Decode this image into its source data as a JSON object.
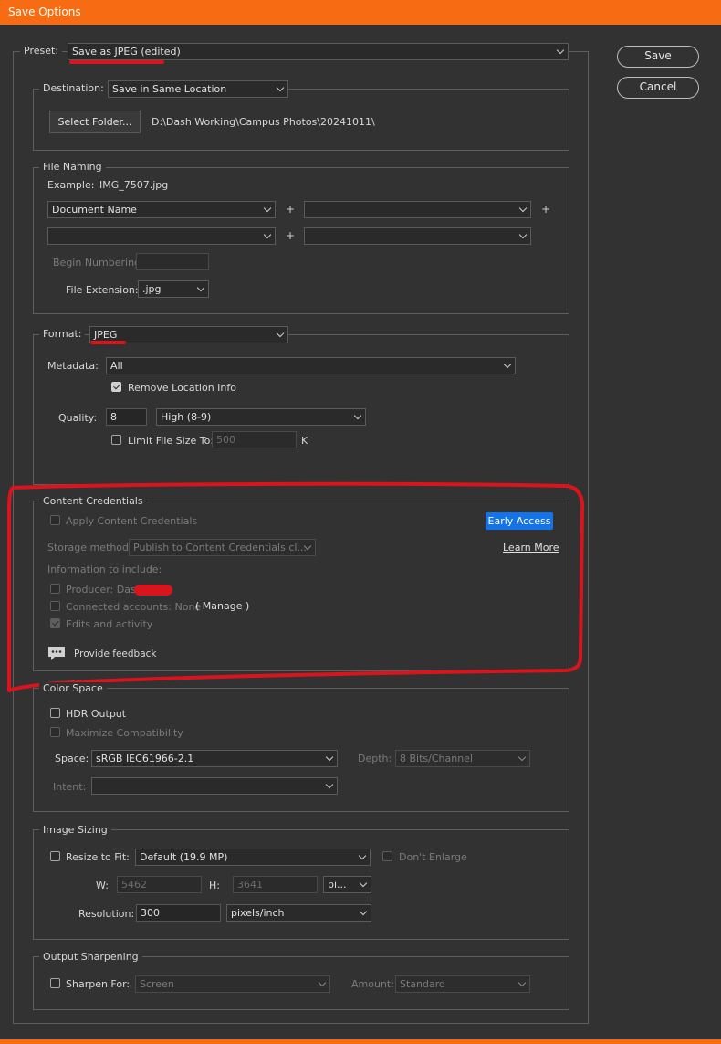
{
  "window": {
    "title": "Save Options"
  },
  "preset": {
    "label": "Preset:",
    "value": "Save as JPEG (edited)"
  },
  "buttons": {
    "save": "Save",
    "cancel": "Cancel"
  },
  "destination": {
    "label": "Destination:",
    "value": "Save in Same Location",
    "select_folder": "Select Folder...",
    "path": "D:\\Dash Working\\Campus Photos\\20241011\\"
  },
  "file_naming": {
    "title": "File Naming",
    "example_label": "Example:",
    "example_value": "IMG_7507.jpg",
    "field1": "Document Name",
    "field2": "",
    "field3": "",
    "field4": "",
    "plus": "+",
    "begin_numbering_label": "Begin Numbering:",
    "begin_numbering_value": "",
    "file_ext_label": "File Extension:",
    "file_ext_value": ".jpg"
  },
  "format": {
    "label": "Format:",
    "value": "JPEG",
    "metadata_label": "Metadata:",
    "metadata_value": "All",
    "remove_location": "Remove Location Info",
    "quality_label": "Quality:",
    "quality_value": "8",
    "quality_preset": "High  (8-9)",
    "limit_file_size": "Limit File Size To:",
    "limit_value": "500",
    "limit_unit": "K"
  },
  "content_credentials": {
    "title": "Content Credentials",
    "apply": "Apply Content Credentials",
    "early_access": "Early Access",
    "storage_label": "Storage method:",
    "storage_value": "Publish to Content Credentials cl...",
    "learn_more": "Learn More",
    "info_label": "Information to include:",
    "producer": "Producer: Dash",
    "connected": "Connected accounts: None",
    "manage": "( Manage  )",
    "edits": "Edits and activity",
    "feedback": "Provide feedback"
  },
  "color_space": {
    "title": "Color Space",
    "hdr": "HDR Output",
    "maximize": "Maximize Compatibility",
    "space_label": "Space:",
    "space_value": "sRGB IEC61966-2.1",
    "depth_label": "Depth:",
    "depth_value": "8 Bits/Channel",
    "intent_label": "Intent:",
    "intent_value": ""
  },
  "image_sizing": {
    "title": "Image Sizing",
    "resize": "Resize to Fit:",
    "resize_value": "Default  (19.9 MP)",
    "dont_enlarge": "Don't Enlarge",
    "w_label": "W:",
    "w_value": "5462",
    "h_label": "H:",
    "h_value": "3641",
    "unit_value": "pi...",
    "resolution_label": "Resolution:",
    "resolution_value": "300",
    "resolution_unit": "pixels/inch"
  },
  "output_sharpening": {
    "title": "Output Sharpening",
    "sharpen_for": "Sharpen For:",
    "sharpen_value": "Screen",
    "amount_label": "Amount:",
    "amount_value": "Standard"
  },
  "colors": {
    "accent": "#f76c12",
    "early_access": "#1473e6",
    "annotation": "#d8141c"
  },
  "state": {
    "remove_location_checked": true,
    "edits_checked": true,
    "apply_checked": false,
    "limit_checked": false
  }
}
